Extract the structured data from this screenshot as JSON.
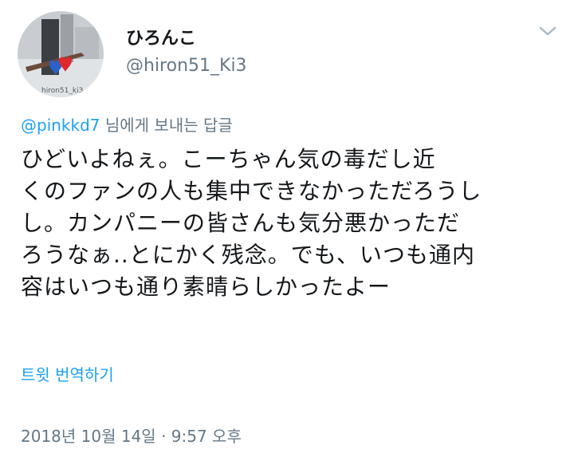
{
  "author": {
    "display_name": "ひろんこ",
    "handle": "@hiron51_Ki3",
    "avatar_caption": "hiron51_ki3"
  },
  "icons": {
    "menu": "chevron-down-icon",
    "avatar_hearts": "heart-icon"
  },
  "reply": {
    "mention": "@pinkkd7",
    "suffix": " 님에게 보내는 답글"
  },
  "tweet": {
    "lines": [
      "ひどいよねぇ。こーちゃん気の毒だし近",
      "くのファンの人も集中できなかっただろうし",
      "し。カンパニーの皆さんも気分悪かっただ",
      "ろうなぁ..とにかく残念。でも、いつも通内",
      "容はいつも通り素晴らしかったよー"
    ]
  },
  "actions": {
    "translate_label": "트윗 번역하기"
  },
  "meta": {
    "timestamp": "2018년 10월 14일 · 9:57 오후"
  },
  "colors": {
    "accent": "#1da1f2",
    "secondary_text": "#657786",
    "primary_text": "#14171a"
  }
}
